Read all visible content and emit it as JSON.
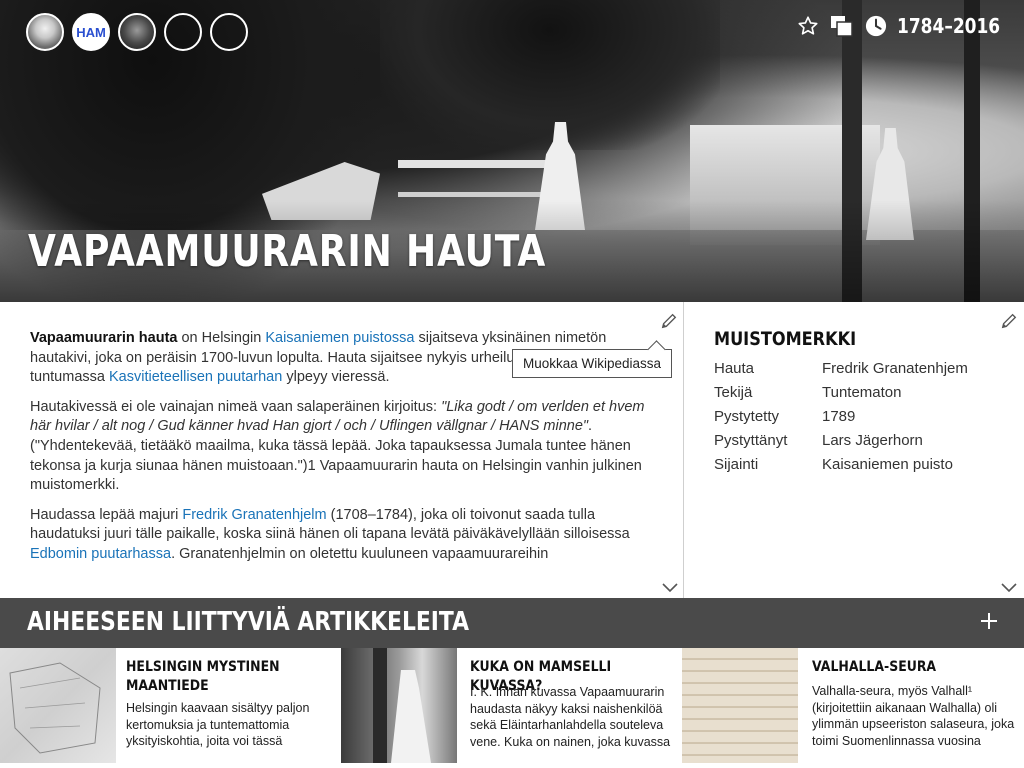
{
  "hero": {
    "title": "VAPAAMUURARIN HAUTA",
    "years": "1784–2016",
    "avatars": [
      {
        "name": "user-avatar"
      },
      {
        "name": "ham-logo",
        "label": "HAM"
      },
      {
        "name": "portrait-avatar"
      },
      {
        "name": "empty-avatar"
      },
      {
        "name": "silhouette-avatar"
      }
    ],
    "icons": [
      "star-icon",
      "layers-icon",
      "clock-icon"
    ]
  },
  "article": {
    "tooltip": "Muokkaa Wikipediassa",
    "p1_bold": "Vapaamuurarin hauta",
    "p1_a": " on Helsingin ",
    "p1_link1": "Kaisaniemen puistossa",
    "p1_b": " sijaitseva yksinäinen nimetön hautakivi, joka on peräisin 1700-luvun lopulta. Hauta sijaitsee nykyis",
    "p1_c": "urheilukentän koillisk",
    "p1_d": "ulman tuntumassa ",
    "p1_link2": "Kasvitieteellisen puutarhan",
    "p1_e": " ylpeyy",
    "p1_f": "vieressä.",
    "p2_a": "Hautakivessä ei ole vainajan nimeä vaan salaperäinen kirjoitus: ",
    "p2_quote": "\"Lika godt / om verlden et hvem här hvilar / alt nog / Gud känner hvad Han gjort / och / Uflingen vällgnar / HANS minne\"",
    "p2_b": ". (\"Yhdentekevää, tietääkö maailma, kuka tässä lepää. Joka tapauksessa Jumala tuntee hänen tekonsa ja kurja siunaa hänen muistoaan.\")1 Vapaamuurarin hauta on Helsingin vanhin julkinen muistomerkki.",
    "p3_a": "Haudassa lepää majuri ",
    "p3_link1": "Fredrik Granatenhjelm",
    "p3_b": " (1708–1784), joka oli toivonut saada tulla haudatuksi juuri tälle paikalle, koska siinä hänen oli tapana levätä päiväkävelyllään silloisessa ",
    "p3_link2": "Edbomin puutarhassa",
    "p3_c": ". Granatenhjelmin on oletettu kuuluneen vapaamuurareihin"
  },
  "infobox": {
    "title": "MUISTOMERKKI",
    "rows": [
      {
        "key": "Hauta",
        "value": "Fredrik Granatenhjem",
        "link": true
      },
      {
        "key": "Tekijä",
        "value": "Tuntematon",
        "link": false
      },
      {
        "key": "Pystytetty",
        "value": "1789",
        "link": false
      },
      {
        "key": "Pystyttänyt",
        "value": "Lars Jägerhorn",
        "link": true
      },
      {
        "key": "Sijainti",
        "value": "Kaisaniemen puisto",
        "link": true
      }
    ]
  },
  "related": {
    "title": "AIHEESEEN LIITTYVIÄ ARTIKKELEITA",
    "cards": [
      {
        "title": "HELSINGIN MYSTINEN MAANTIEDE",
        "desc": "Helsingin kaavaan sisältyy paljon kertomuksia ja tuntemattomia yksityiskohtia, joita voi tässä"
      },
      {
        "title": "KUKA ON MAMSELLI KUVASSA?",
        "desc": "I. K. Inhan kuvassa Vapaamuurarin haudasta näkyy kaksi naishenkilöä sekä Eläintarhanlahdella souteleva vene. Kuka on nainen, joka kuvassa"
      },
      {
        "title": "VALHALLA-SEURA",
        "desc": "Valhalla-seura, myös Valhall¹ (kirjoitettiin aikanaan Walhalla) oli ylimmän upseeriston salaseura, joka toimi Suomenlinnassa vuosina"
      }
    ]
  }
}
